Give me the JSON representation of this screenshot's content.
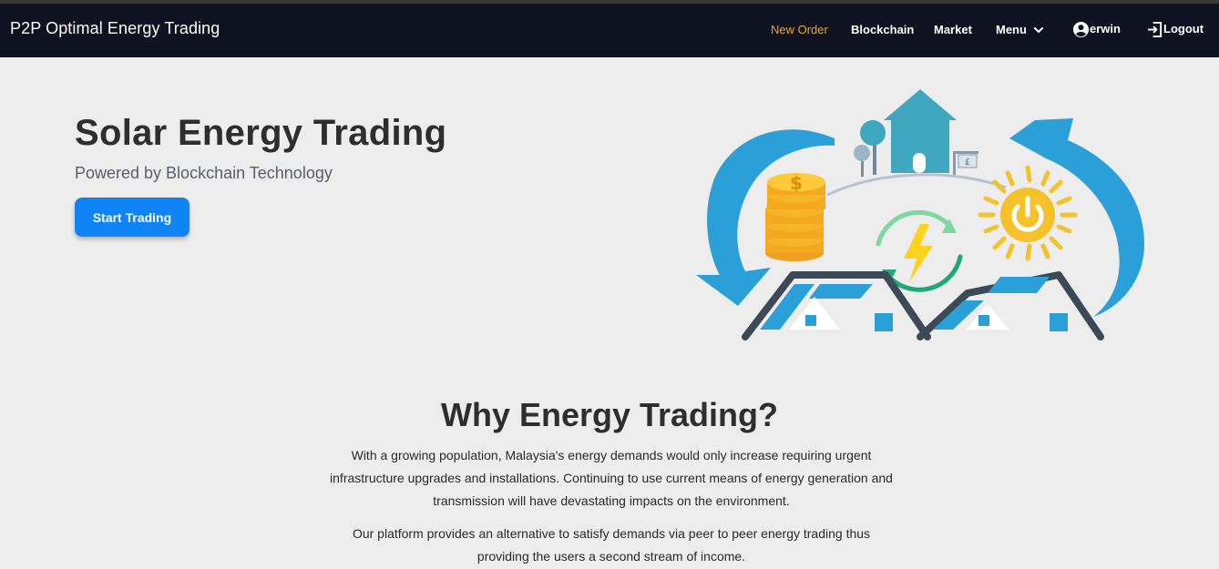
{
  "navbar": {
    "brand": "P2P Optimal Energy Trading",
    "items": {
      "new_order": "New Order",
      "blockchain": "Blockchain",
      "market": "Market",
      "menu": "Menu",
      "user": "erwin",
      "logout": "Logout"
    },
    "icons": {
      "menu": "chevron-down-icon",
      "user": "account-circle-icon",
      "logout": "logout-icon"
    },
    "active_color": "#e3a93a",
    "background": "#0f1220"
  },
  "hero": {
    "title": "Solar Energy Trading",
    "subtitle": "Powered by Blockchain Technology",
    "cta_label": "Start Trading",
    "cta_color": "#0f84f7"
  },
  "why": {
    "title": "Why Energy Trading?",
    "paragraph1": "With a growing population, Malaysia's energy demands would only increase requiring urgent infrastructure upgrades and installations. Continuing to use current means of energy generation and transmission will have devastating impacts on the environment.",
    "paragraph2": "Our platform provides an alternative to satisfy demands via peer to peer energy trading thus providing the users a second stream of income."
  },
  "illustration": {
    "coin_symbol": "$",
    "sign_symbol": "£"
  }
}
